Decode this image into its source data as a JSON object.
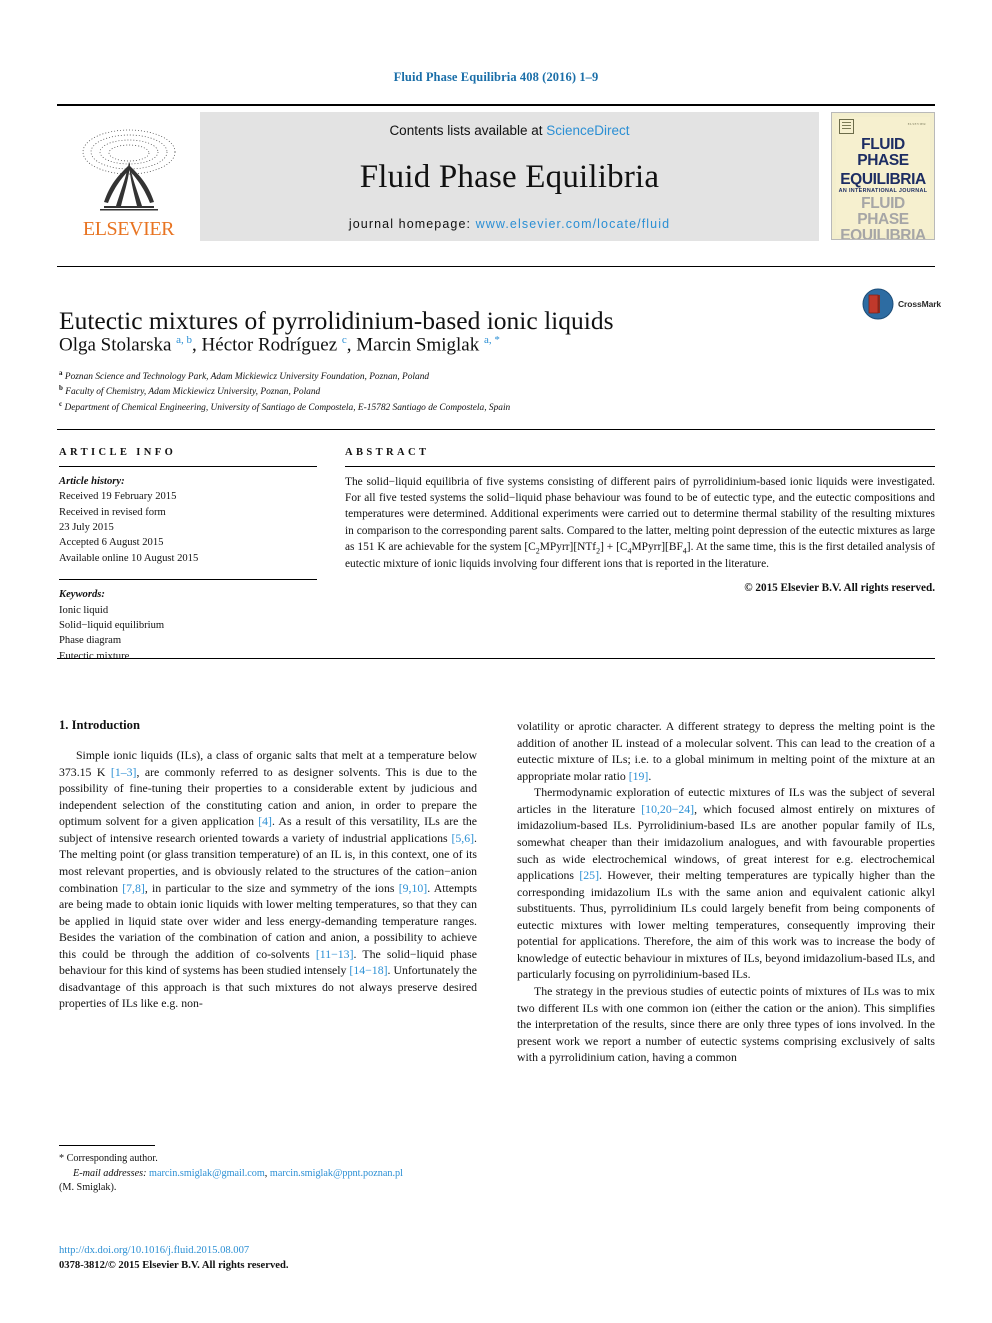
{
  "running_head": "Fluid Phase Equilibria 408 (2016) 1–9",
  "masthead": {
    "contents_prefix": "Contents lists available at ",
    "sciencedirect": "ScienceDirect",
    "journal_name": "Fluid Phase Equilibria",
    "homepage_prefix": "journal homepage: ",
    "homepage_url": "www.elsevier.com/locate/fluid",
    "publisher": "ELSEVIER",
    "cover": {
      "title_line1": "FLUID PHASE",
      "title_line2": "EQUILIBRIA",
      "subtitle": "AN INTERNATIONAL JOURNAL",
      "ghost_line1": "FLUID PHASE",
      "ghost_line2": "EQUILIBRIA",
      "corner_tag": "ELSEVIER"
    }
  },
  "crossmark": {
    "label": "CrossMark"
  },
  "article": {
    "title": "Eutectic mixtures of pyrrolidinium-based ionic liquids",
    "authors": [
      {
        "name": "Olga Stolarska",
        "marks": "a, b",
        "sep": ", "
      },
      {
        "name": "Héctor Rodríguez",
        "marks": "c",
        "sep": ", "
      },
      {
        "name": "Marcin Smiglak",
        "marks": "a, *",
        "sep": ""
      }
    ],
    "affiliations": [
      {
        "mark": "a",
        "text": "Poznan Science and Technology Park, Adam Mickiewicz University Foundation, Poznan, Poland"
      },
      {
        "mark": "b",
        "text": "Faculty of Chemistry, Adam Mickiewicz University, Poznan, Poland"
      },
      {
        "mark": "c",
        "text": "Department of Chemical Engineering, University of Santiago de Compostela, E-15782 Santiago de Compostela, Spain"
      }
    ]
  },
  "article_info": {
    "heading": "ARTICLE INFO",
    "history_label": "Article history:",
    "history": [
      "Received 19 February 2015",
      "Received in revised form",
      "23 July 2015",
      "Accepted 6 August 2015",
      "Available online 10 August 2015"
    ],
    "keywords_label": "Keywords:",
    "keywords": [
      "Ionic liquid",
      "Solid−liquid equilibrium",
      "Phase diagram",
      "Eutectic mixture"
    ]
  },
  "abstract": {
    "heading": "ABSTRACT",
    "part1": "The solid−liquid equilibria of five systems consisting of different pairs of pyrrolidinium-based ionic liquids were investigated. For all five tested systems the solid−liquid phase behaviour was found to be of eutectic type, and the eutectic compositions and temperatures were determined. Additional experiments were carried out to determine thermal stability of the resulting mixtures in comparison to the corresponding parent salts. Compared to the latter, melting point depression of the eutectic mixtures as large as 151 K are achievable for the system [C",
    "sub1": "2",
    "part2": "MPyrr][NTf",
    "sub2": "2",
    "part3": "] + [C",
    "sub3": "4",
    "part4": "MPyrr][BF",
    "sub4": "4",
    "part5": "]. At the same time, this is the first detailed analysis of eutectic mixture of ionic liquids involving four different ions that is reported in the literature.",
    "copyright": "© 2015 Elsevier B.V. All rights reserved."
  },
  "body": {
    "section_number_title": "1. Introduction",
    "left_paragraphs": [
      {
        "segments": [
          {
            "t": "Simple ionic liquids (ILs), a class of organic salts that melt at a temperature below 373.15 K "
          },
          {
            "t": "[1–3]",
            "ref": true
          },
          {
            "t": ", are commonly referred to as designer solvents. This is due to the possibility of fine-tuning their properties to a considerable extent by judicious and independent selection of the constituting cation and anion, in order to prepare the optimum solvent for a given application "
          },
          {
            "t": "[4]",
            "ref": true
          },
          {
            "t": ". As a result of this versatility, ILs are the subject of intensive research oriented towards a variety of industrial applications "
          },
          {
            "t": "[5,6]",
            "ref": true
          },
          {
            "t": ". The melting point (or glass transition temperature) of an IL is, in this context, one of its most relevant properties, and is obviously related to the structures of the cation−anion combination "
          },
          {
            "t": "[7,8]",
            "ref": true
          },
          {
            "t": ", in particular to the size and symmetry of the ions "
          },
          {
            "t": "[9,10]",
            "ref": true
          },
          {
            "t": ". Attempts are being made to obtain ionic liquids with lower melting temperatures, so that they can be applied in liquid state over wider and less energy-demanding temperature ranges. Besides the variation of the combination of cation and anion, a possibility to achieve this could be through the addition of co-solvents "
          },
          {
            "t": "[11−13]",
            "ref": true
          },
          {
            "t": ". The solid−liquid phase behaviour for this kind of systems has been studied intensely "
          },
          {
            "t": "[14−18]",
            "ref": true
          },
          {
            "t": ". Unfortunately the disadvantage of this approach is that such mixtures do not always preserve desired properties of ILs like e.g. non-"
          }
        ]
      }
    ],
    "right_paragraphs": [
      {
        "segments": [
          {
            "t": "volatility or aprotic character. A different strategy to depress the melting point is the addition of another IL instead of a molecular solvent. This can lead to the creation of a eutectic mixture of ILs; i.e. to a global minimum in melting point of the mixture at an appropriate molar ratio "
          },
          {
            "t": "[19]",
            "ref": true
          },
          {
            "t": "."
          }
        ],
        "noindent_first": true
      },
      {
        "segments": [
          {
            "t": "Thermodynamic exploration of eutectic mixtures of ILs was the subject of several articles in the literature "
          },
          {
            "t": "[10,20−24]",
            "ref": true
          },
          {
            "t": ", which focused almost entirely on mixtures of imidazolium-based ILs. Pyrrolidinium-based ILs are another popular family of ILs, somewhat cheaper than their imidazolium analogues, and with favourable properties such as wide electrochemical windows, of great interest for e.g. electrochemical applications "
          },
          {
            "t": "[25]",
            "ref": true
          },
          {
            "t": ". However, their melting temperatures are typically higher than the corresponding imidazolium ILs with the same anion and equivalent cationic alkyl substituents. Thus, pyrrolidinium ILs could largely benefit from being components of eutectic mixtures with lower melting temperatures, consequently improving their potential for applications. Therefore, the aim of this work was to increase the body of knowledge of eutectic behaviour in mixtures of ILs, beyond imidazolium-based ILs, and particularly focusing on pyrrolidinium-based ILs."
          }
        ]
      },
      {
        "segments": [
          {
            "t": "The strategy in the previous studies of eutectic points of mixtures of ILs was to mix two different ILs with one common ion (either the cation or the anion). This simplifies the interpretation of the results, since there are only three types of ions involved. In the present work we report a number of eutectic systems comprising exclusively of salts with a pyrrolidinium cation, having a common"
          }
        ]
      }
    ]
  },
  "footer": {
    "corresponding_mark": "*",
    "corresponding_label": "Corresponding author.",
    "email_label": "E-mail addresses:",
    "email1": "marcin.smiglak@gmail.com",
    "email_sep": ", ",
    "email2": "marcin.smiglak@ppnt.poznan.pl",
    "email_owner": "(M. Smiglak).",
    "doi": "http://dx.doi.org/10.1016/j.fluid.2015.08.007",
    "issn_line": "0378-3812/© 2015 Elsevier B.V. All rights reserved."
  },
  "colors": {
    "link": "#2b8fd4",
    "running_head": "#1a6ea8",
    "elsevier_orange": "#e87422",
    "masthead_bg": "#e3e3e3",
    "cover_bg": "#f6f0cf",
    "cover_title": "#1d2d63"
  }
}
